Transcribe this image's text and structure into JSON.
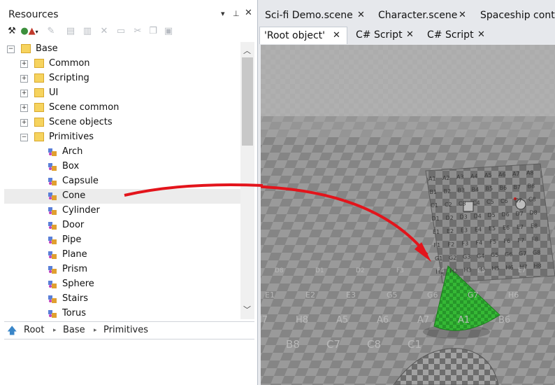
{
  "panel": {
    "title": "Resources",
    "header_icons": [
      "dropdown-icon",
      "pin-icon",
      "close-icon"
    ]
  },
  "toolbar": [
    "tools-icon",
    "add-resource-icon",
    "edit-icon",
    "rename-icon",
    "new-icon",
    "delete-icon",
    "properties-icon",
    "cut-icon",
    "copy-icon",
    "paste-icon"
  ],
  "tree": [
    {
      "label": "Base",
      "level": 0,
      "expander": "-",
      "icon": "folder"
    },
    {
      "label": "Common",
      "level": 1,
      "expander": "+",
      "icon": "folder"
    },
    {
      "label": "Scripting",
      "level": 1,
      "expander": "+",
      "icon": "folder"
    },
    {
      "label": "UI",
      "level": 1,
      "expander": "+",
      "icon": "folder"
    },
    {
      "label": "Scene common",
      "level": 1,
      "expander": "+",
      "icon": "folder"
    },
    {
      "label": "Scene objects",
      "level": 1,
      "expander": "+",
      "icon": "folder"
    },
    {
      "label": "Primitives",
      "level": 1,
      "expander": "-",
      "icon": "folder"
    },
    {
      "label": "Arch",
      "level": 2,
      "icon": "primitive"
    },
    {
      "label": "Box",
      "level": 2,
      "icon": "primitive"
    },
    {
      "label": "Capsule",
      "level": 2,
      "icon": "primitive"
    },
    {
      "label": "Cone",
      "level": 2,
      "icon": "primitive",
      "selected": true
    },
    {
      "label": "Cylinder",
      "level": 2,
      "icon": "primitive"
    },
    {
      "label": "Door",
      "level": 2,
      "icon": "primitive"
    },
    {
      "label": "Pipe",
      "level": 2,
      "icon": "primitive"
    },
    {
      "label": "Plane",
      "level": 2,
      "icon": "primitive"
    },
    {
      "label": "Prism",
      "level": 2,
      "icon": "primitive"
    },
    {
      "label": "Sphere",
      "level": 2,
      "icon": "primitive"
    },
    {
      "label": "Stairs",
      "level": 2,
      "icon": "primitive"
    },
    {
      "label": "Torus",
      "level": 2,
      "icon": "primitive"
    }
  ],
  "breadcrumb": {
    "items": [
      "Root",
      "Base",
      "Primitives"
    ]
  },
  "tabs_top": [
    {
      "label": "Sci-fi Demo.scene",
      "closable": true
    },
    {
      "label": "Character.scene",
      "closable": true
    },
    {
      "label": "Spaceship contr",
      "closable": false
    }
  ],
  "tabs_second": [
    {
      "label": "'Root object'",
      "closable": true,
      "active": true
    },
    {
      "label": "C# Script",
      "closable": true
    },
    {
      "label": "C# Script",
      "closable": true
    }
  ],
  "scene": {
    "wall_labels": [
      "A1",
      "A2",
      "A3",
      "A4",
      "A5",
      "A6",
      "A7",
      "A8",
      "B1",
      "B2",
      "B3",
      "B4",
      "B5",
      "B6",
      "B7",
      "B8",
      "C1",
      "C2",
      "C3",
      "C4",
      "C5",
      "C6",
      "C7",
      "C8",
      "D1",
      "D2",
      "D3",
      "D4",
      "D5",
      "D6",
      "D7",
      "D8",
      "E1",
      "E2",
      "E3",
      "E4",
      "E5",
      "E6",
      "E7",
      "E8",
      "F1",
      "F2",
      "F3",
      "F4",
      "F5",
      "F6",
      "F7",
      "F8",
      "G1",
      "G2",
      "G3",
      "G4",
      "G5",
      "G6",
      "G7",
      "G8",
      "H1",
      "H2",
      "H3",
      "H4",
      "H5",
      "H6",
      "H7",
      "H8"
    ],
    "floor_labels": [
      "D8",
      "D1",
      "D2",
      "F3",
      "F4",
      "E5",
      "E7",
      "E1",
      "E2",
      "E3",
      "G5",
      "G6",
      "G7",
      "H6",
      "H7",
      "H8",
      "A5",
      "A6",
      "A7",
      "A1",
      "B6",
      "B7",
      "B8",
      "C7",
      "C8",
      "C1"
    ],
    "cone_color": "#2fb02f",
    "arrow_color": "#e3141b"
  },
  "colors": {
    "accent": "#3a6ea5",
    "folder": "#f6d35e"
  }
}
